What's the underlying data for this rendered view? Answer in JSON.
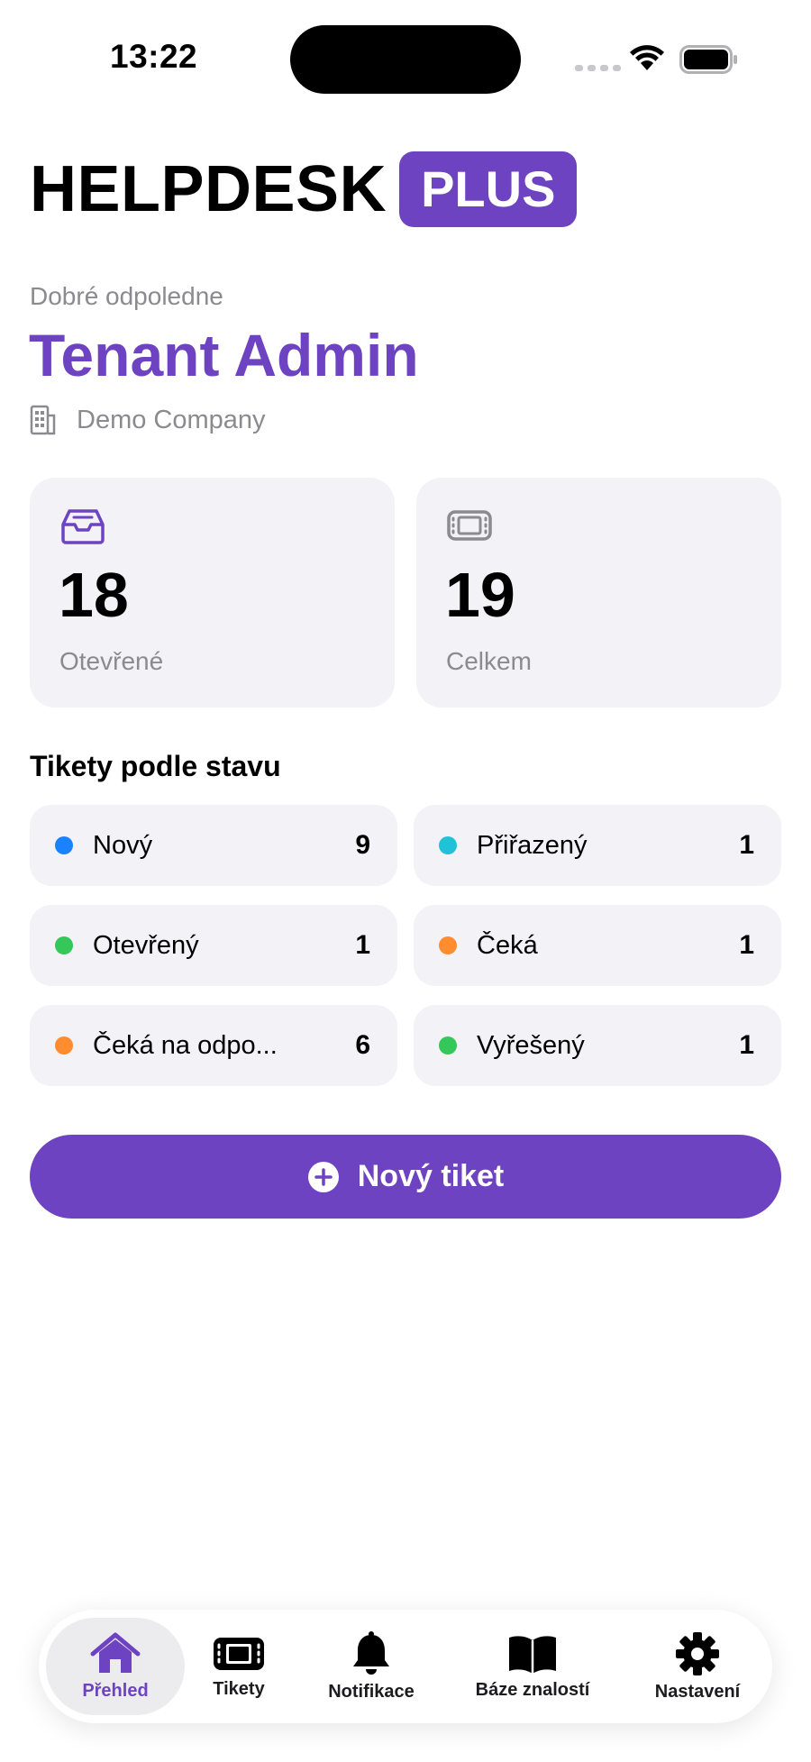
{
  "status_bar": {
    "time": "13:22"
  },
  "header": {
    "brand": "HELPDESK",
    "brand_badge": "PLUS"
  },
  "user": {
    "greeting": "Dobré odpoledne",
    "name": "Tenant Admin",
    "company": "Demo Company"
  },
  "stats": [
    {
      "value": "18",
      "label": "Otevřené",
      "icon": "inbox-icon"
    },
    {
      "value": "19",
      "label": "Celkem",
      "icon": "ticket-icon"
    }
  ],
  "section": {
    "title": "Tikety podle stavu"
  },
  "statuses": [
    {
      "name": "Nový",
      "count": "9",
      "color": "#1a82ff"
    },
    {
      "name": "Přiřazený",
      "count": "1",
      "color": "#1fc2d6"
    },
    {
      "name": "Otevřený",
      "count": "1",
      "color": "#34c759"
    },
    {
      "name": "Čeká",
      "count": "1",
      "color": "#ff8c2e"
    },
    {
      "name": "Čeká na odpo...",
      "count": "6",
      "color": "#ff8c2e"
    },
    {
      "name": "Vyřešený",
      "count": "1",
      "color": "#34c759"
    }
  ],
  "actions": {
    "new_ticket": "Nový tiket"
  },
  "tabs": [
    {
      "label": "Přehled",
      "icon": "home-icon",
      "active": true
    },
    {
      "label": "Tikety",
      "icon": "ticket-icon",
      "active": false
    },
    {
      "label": "Notifikace",
      "icon": "bell-icon",
      "active": false
    },
    {
      "label": "Báze znalostí",
      "icon": "book-icon",
      "active": false
    },
    {
      "label": "Nastavení",
      "icon": "gear-icon",
      "active": false
    }
  ],
  "colors": {
    "accent": "#6e43c1",
    "card": "#f2f2f7",
    "muted": "#8a8a8f"
  }
}
